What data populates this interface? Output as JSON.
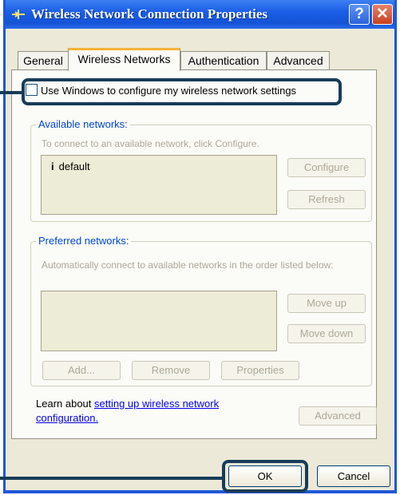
{
  "window": {
    "title": "Wireless Network Connection Properties",
    "help_label": "?",
    "close_label": "✕"
  },
  "tabs": [
    "General",
    "Wireless Networks",
    "Authentication",
    "Advanced"
  ],
  "active_tab": "Wireless Networks",
  "use_windows_checkbox": {
    "label": "Use Windows to configure my wireless network settings",
    "checked": false
  },
  "available_networks": {
    "legend": "Available networks:",
    "hint": "To connect to an available network, click Configure.",
    "items": [
      "default"
    ],
    "configure_label": "Configure",
    "refresh_label": "Refresh"
  },
  "preferred_networks": {
    "legend": "Preferred networks:",
    "hint": "Automatically connect to available networks in the order listed below:",
    "move_up_label": "Move up",
    "move_down_label": "Move down",
    "add_label": "Add...",
    "remove_label": "Remove",
    "properties_label": "Properties"
  },
  "learn_more": {
    "prefix": "Learn about ",
    "link": "setting up wireless network configuration."
  },
  "advanced_label": "Advanced",
  "ok_label": "OK",
  "cancel_label": "Cancel",
  "colors": {
    "titlebar": "#1b5fe6",
    "dialog_bg": "#ece9d8",
    "panel_bg": "#fbfbf7",
    "legend_text": "#0046d5",
    "callout": "#183c58"
  }
}
